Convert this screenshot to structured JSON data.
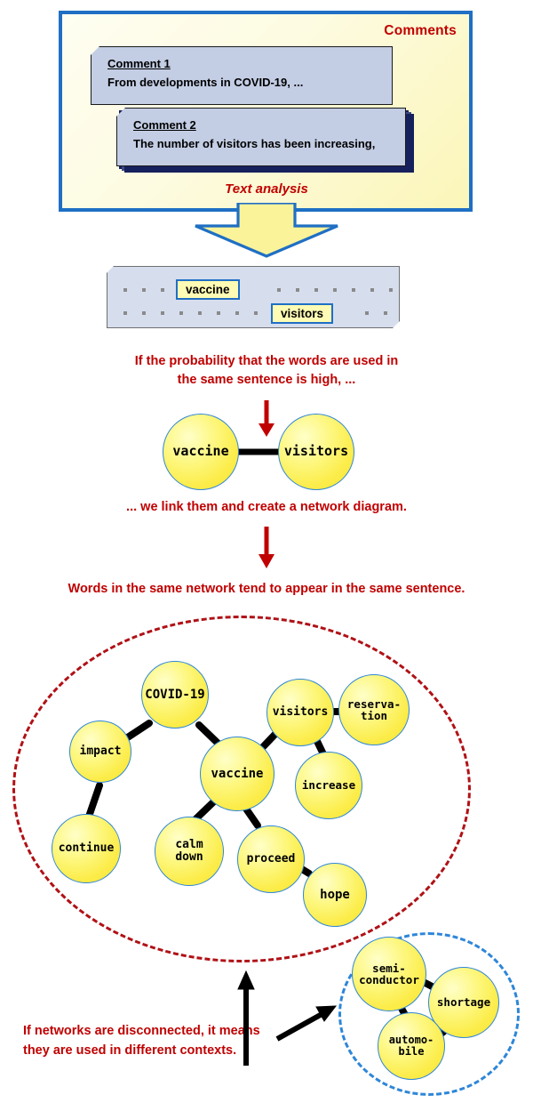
{
  "comments_panel": {
    "title": "Comments",
    "notes": [
      {
        "title": "Comment 1",
        "body": "From developments in COVID-19, ..."
      },
      {
        "title": "Comment 2",
        "body": "The number of visitors has been increasing,"
      }
    ],
    "process_label": "Text analysis"
  },
  "text_panel": {
    "tags": [
      {
        "label": "vaccine"
      },
      {
        "label": "visitors"
      }
    ]
  },
  "captions": {
    "probability": "If the probability that the words are used in\nthe same sentence is high, ...",
    "link": "... we link them and create a network diagram.",
    "same_network": "Words in the same network tend to appear in the same sentence.",
    "disconnected": "If networks are disconnected, it means\nthey are used in different contexts."
  },
  "pair_network": {
    "nodes": [
      {
        "id": "vaccine",
        "label": "vaccine"
      },
      {
        "id": "visitors",
        "label": "visitors"
      }
    ],
    "edges": [
      [
        "vaccine",
        "visitors"
      ]
    ]
  },
  "main_network": {
    "nodes": [
      {
        "id": "covid19",
        "label": "COVID-19"
      },
      {
        "id": "impact",
        "label": "impact"
      },
      {
        "id": "continue",
        "label": "continue"
      },
      {
        "id": "vaccine",
        "label": "vaccine"
      },
      {
        "id": "calmdown",
        "label": "calm\ndown"
      },
      {
        "id": "proceed",
        "label": "proceed"
      },
      {
        "id": "hope",
        "label": "hope"
      },
      {
        "id": "visitors",
        "label": "visitors"
      },
      {
        "id": "reservation",
        "label": "reserva-\ntion"
      },
      {
        "id": "increase",
        "label": "increase"
      }
    ],
    "edges": [
      [
        "covid19",
        "impact"
      ],
      [
        "covid19",
        "vaccine"
      ],
      [
        "impact",
        "continue"
      ],
      [
        "vaccine",
        "calmdown"
      ],
      [
        "vaccine",
        "proceed"
      ],
      [
        "proceed",
        "hope"
      ],
      [
        "vaccine",
        "visitors"
      ],
      [
        "visitors",
        "reservation"
      ],
      [
        "visitors",
        "increase"
      ]
    ]
  },
  "secondary_network": {
    "nodes": [
      {
        "id": "semiconductor",
        "label": "semi-\nconductor"
      },
      {
        "id": "shortage",
        "label": "shortage"
      },
      {
        "id": "automobile",
        "label": "automo-\nbile"
      }
    ],
    "edges": [
      [
        "semiconductor",
        "shortage"
      ],
      [
        "semiconductor",
        "automobile"
      ],
      [
        "shortage",
        "automobile"
      ]
    ]
  },
  "colors": {
    "accent_blue": "#1F6FC4",
    "node_blue": "#2E86D8",
    "caption_red": "#C00000",
    "ellipse_red": "#B01116",
    "note_blue": "#C3CDE4",
    "panel_gray": "#D6DEEE",
    "tag_yellow": "#FDFBB4"
  }
}
